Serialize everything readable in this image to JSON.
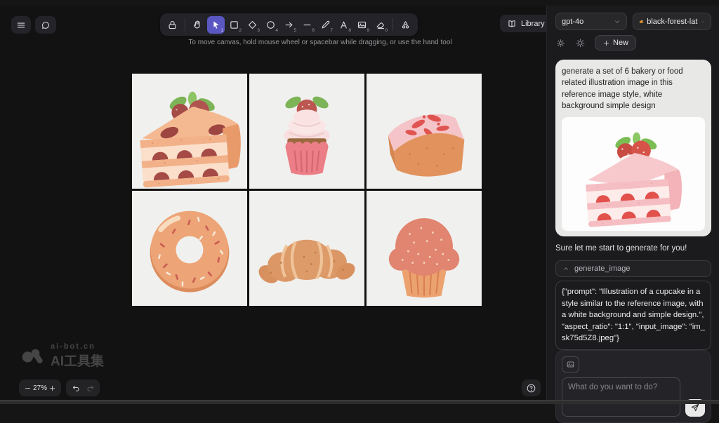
{
  "toolbar": {
    "hint": "To move canvas, hold mouse wheel or spacebar while dragging, or use the hand tool",
    "tools": [
      {
        "name": "lock",
        "shortcut": ""
      },
      {
        "name": "hand",
        "shortcut": ""
      },
      {
        "name": "selection",
        "shortcut": "1",
        "selected": true
      },
      {
        "name": "rectangle",
        "shortcut": "2"
      },
      {
        "name": "diamond",
        "shortcut": "3"
      },
      {
        "name": "ellipse",
        "shortcut": "4"
      },
      {
        "name": "arrow",
        "shortcut": "5"
      },
      {
        "name": "line",
        "shortcut": "6"
      },
      {
        "name": "draw",
        "shortcut": "7"
      },
      {
        "name": "text",
        "shortcut": "8"
      },
      {
        "name": "image",
        "shortcut": "9"
      },
      {
        "name": "eraser",
        "shortcut": "0"
      },
      {
        "name": "more-tools",
        "shortcut": ""
      }
    ]
  },
  "topbar": {
    "library": "Library"
  },
  "sidebar": {
    "model": "gpt-4o",
    "provider": "black-forest-lat",
    "new_label": "New",
    "user_message": "generate a set of 6 bakery or food related illustration image in this reference image style, white background simple design",
    "assistant_message": "Sure let me start to generate for you!",
    "tool_call": {
      "name": "generate_image",
      "arguments": "{\"prompt\": \"Illustration of a cupcake in a style similar to the reference image, with a white background and simple design.\", \"aspect_ratio\": \"1:1\", \"input_image\": \"im_sk75d5Z8.jpeg\"}"
    },
    "composer_placeholder": "What do you want to do?"
  },
  "canvas": {
    "images": [
      {
        "name": "strawberry-cake-slice"
      },
      {
        "name": "strawberry-cupcake"
      },
      {
        "name": "strawberry-loaf-cake"
      },
      {
        "name": "sprinkle-donut"
      },
      {
        "name": "croissant"
      },
      {
        "name": "muffin"
      }
    ]
  },
  "statusbar": {
    "zoom": "27%"
  },
  "watermark": {
    "line1": "ai-bot.cn",
    "line2": "AI工具集"
  },
  "colors": {
    "accent": "#5b57c2",
    "canvas_bg": "#121212",
    "sidebar_bg": "#1b1b1e",
    "cell_bg": "#f0f0ee",
    "user_bubble": "#e8e8e6"
  }
}
